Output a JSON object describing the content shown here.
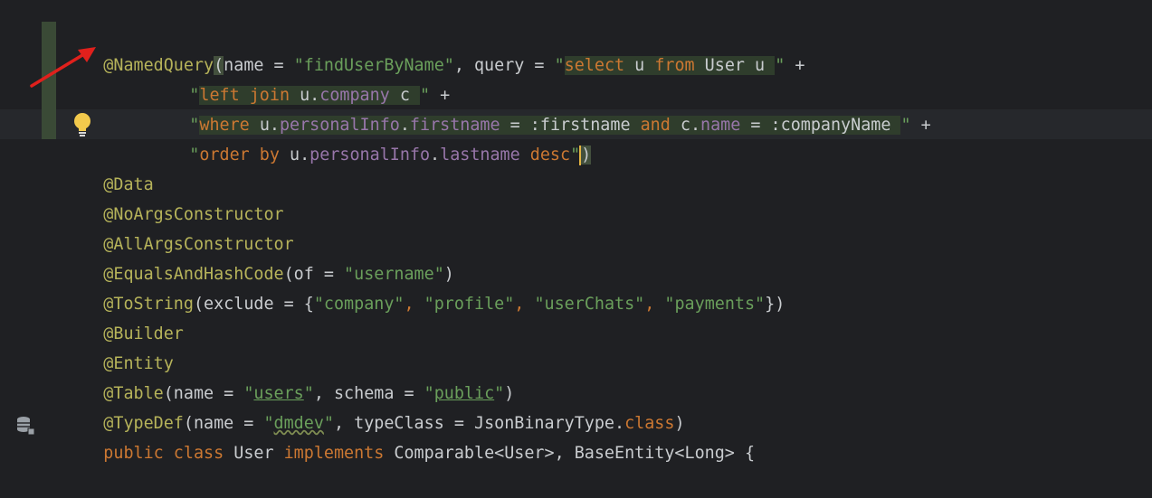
{
  "colors": {
    "background": "#1f2023",
    "annotation": "#b6b35a",
    "string": "#6a9f5b",
    "keyword": "#cc7832",
    "field": "#9876aa",
    "text": "#c9cccf",
    "arrow": "#e0201c"
  },
  "icons": [
    "lightbulb-icon",
    "database-icon",
    "red-arrow-icon"
  ],
  "code": {
    "l1": {
      "ann": "@NamedQuery",
      "paren": "(",
      "a": "name = ",
      "s1": "\"findUserByName\"",
      "b": ", query = ",
      "q": "\"",
      "k1": "select",
      "c": " u ",
      "k2": "from",
      "d": " User u ",
      "q2": "\"",
      "e": " +"
    },
    "l2": {
      "q": "\"",
      "k1": "left join",
      "a": " u.",
      "f1": "company",
      "b": " c ",
      "q2": "\"",
      "e": " +"
    },
    "l3": {
      "q": "\"",
      "k1": "where",
      "a": " u.",
      "f1": "personalInfo",
      "b": ".",
      "f2": "firstname",
      "c": " = :firstname ",
      "k2": "and",
      "d": " c.",
      "f3": "name",
      "g": " = :companyName ",
      "q2": "\"",
      "e": " +"
    },
    "l4": {
      "q": "\"",
      "k1": "order by",
      "a": " u.",
      "f1": "personalInfo",
      "b": ".",
      "f2": "lastname",
      "c": " ",
      "k2": "desc",
      "q2": "\"",
      "paren": ")"
    },
    "l5": {
      "ann": "@Data"
    },
    "l6": {
      "ann": "@NoArgsConstructor"
    },
    "l7": {
      "ann": "@AllArgsConstructor"
    },
    "l8": {
      "ann": "@EqualsAndHashCode",
      "a": "(of = ",
      "s1": "\"username\"",
      "b": ")"
    },
    "l9": {
      "ann": "@ToString",
      "a": "(exclude = {",
      "s1": "\"company\"",
      "c1": ", ",
      "s2": "\"profile\"",
      "c2": ", ",
      "s3": "\"userChats\"",
      "c3": ", ",
      "s4": "\"payments\"",
      "b": "})"
    },
    "l10": {
      "ann": "@Builder"
    },
    "l11": {
      "ann": "@Entity"
    },
    "l12": {
      "ann": "@Table",
      "a": "(name = ",
      "q1": "\"",
      "s1": "users",
      "q1b": "\"",
      "b": ", schema = ",
      "q2": "\"",
      "s2": "public",
      "q2b": "\"",
      "c": ")"
    },
    "l13": {
      "ann": "@TypeDef",
      "a": "(name = ",
      "q1": "\"",
      "s1": "dmdev",
      "q1b": "\"",
      "b": ", typeClass = JsonBinaryType.",
      "k1": "class",
      "c": ")"
    },
    "l14": {
      "k1": "public class",
      "a": " User ",
      "k2": "implements",
      "b": " Comparable<User>, BaseEntity<Long> {"
    }
  }
}
